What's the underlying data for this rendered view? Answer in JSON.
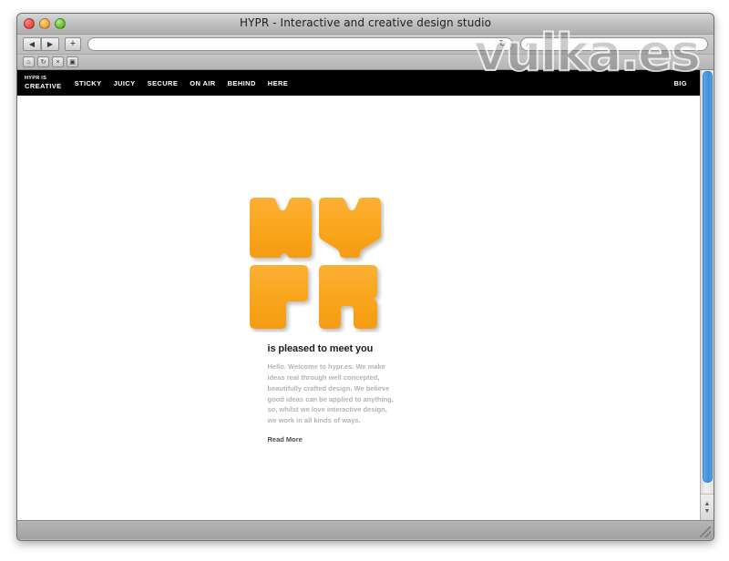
{
  "window": {
    "title": "HYPR - Interactive and creative design studio",
    "traffic_lights": {
      "close": "close-button",
      "minimize": "minimize-button",
      "zoom": "zoom-button"
    }
  },
  "toolbar": {
    "back_icon": "◀",
    "forward_icon": "▶",
    "new_tab_icon": "+",
    "url_value": "",
    "url_placeholder": "",
    "reload_icon": "↻",
    "search_value": "",
    "search_placeholder": "",
    "search_icon": "⌕"
  },
  "subtoolbar": {
    "buttons": [
      {
        "name": "home-button",
        "glyph": "⌂"
      },
      {
        "name": "refresh-button",
        "glyph": "↻"
      },
      {
        "name": "stop-button",
        "glyph": "×"
      },
      {
        "name": "bookmarks-button",
        "glyph": "▣"
      }
    ]
  },
  "site_nav": {
    "brand_line1": "HYPR IS",
    "brand_line2": "CREATIVE",
    "links": [
      {
        "label": "STICKY"
      },
      {
        "label": "JUICY"
      },
      {
        "label": "SECURE"
      },
      {
        "label": "ON AIR"
      },
      {
        "label": "BEHIND"
      },
      {
        "label": "HERE"
      }
    ],
    "right_label": "BIG"
  },
  "hero": {
    "logo_alt": "HYPR blocks logo",
    "logo_color": "#F9A826",
    "logo_shadow": "#C97A10",
    "heading": "is pleased to meet you",
    "body": "Hello. Welcome to hypr.es. We make ideas real through well concepted, beautifully crafted design. We believe good ideas can be applied to anything, so, whilst we love interactive design, we work in all kinds of ways.",
    "read_more": "Read More"
  },
  "scrollbar": {
    "up_arrow": "▲",
    "down_arrow": "▼",
    "thumb_color": "#4a9ae2"
  },
  "watermark": {
    "text": "vulka.es"
  }
}
